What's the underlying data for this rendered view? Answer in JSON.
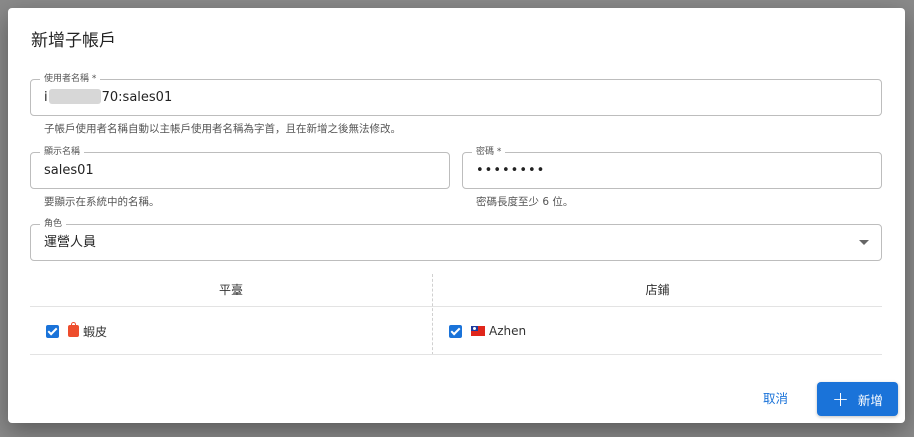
{
  "dialog": {
    "title": "新增子帳戶"
  },
  "username": {
    "label": "使用者名稱 *",
    "prefix": "i",
    "suffix": "70:sales01",
    "helper": "子帳戶使用者名稱自動以主帳戶使用者名稱為字首，且在新增之後無法修改。"
  },
  "display_name": {
    "label": "顯示名稱",
    "value": "sales01",
    "helper": "要顯示在系統中的名稱。"
  },
  "password": {
    "label": "密碼 *",
    "value": "••••••••",
    "helper": "密碼長度至少 6 位。"
  },
  "role": {
    "label": "角色",
    "value": "運營人員",
    "icon": "chevron-down-icon"
  },
  "table": {
    "headers": [
      "平臺",
      "店鋪"
    ],
    "rows": [
      {
        "platform": "蝦皮",
        "platform_checked": true,
        "platform_icon": "shopee-icon",
        "store": "Azhen",
        "store_checked": true,
        "store_icon": "taiwan-flag-icon"
      }
    ]
  },
  "actions": {
    "cancel_label": "取消",
    "add_label": "新增"
  },
  "colors": {
    "primary": "#1a73d9",
    "shopee": "#ee4d2d"
  }
}
